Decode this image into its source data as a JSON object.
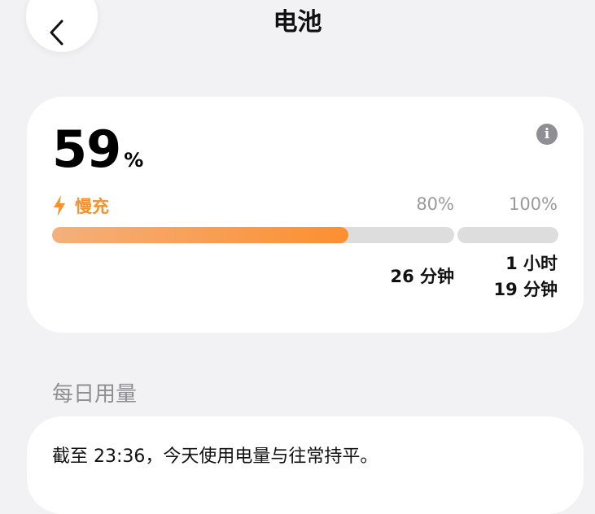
{
  "header": {
    "title": "电池",
    "back_icon": "chevron-left-icon"
  },
  "battery": {
    "percent": "59",
    "percent_sign": "%",
    "level_fraction": 0.59,
    "info_icon": "info-icon",
    "info_glyph": "i",
    "charge_icon": "lightning-bolt-icon",
    "charge_mode": "慢充",
    "accent_color": "#f5922f",
    "markers": {
      "m80": "80%",
      "m100": "100%"
    },
    "eta_80": "26 分钟",
    "eta_100_line1": "1 小时",
    "eta_100_line2": "19 分钟"
  },
  "daily_usage": {
    "heading": "每日用量",
    "summary": "截至 23:36，今天使用电量与往常持平。"
  }
}
